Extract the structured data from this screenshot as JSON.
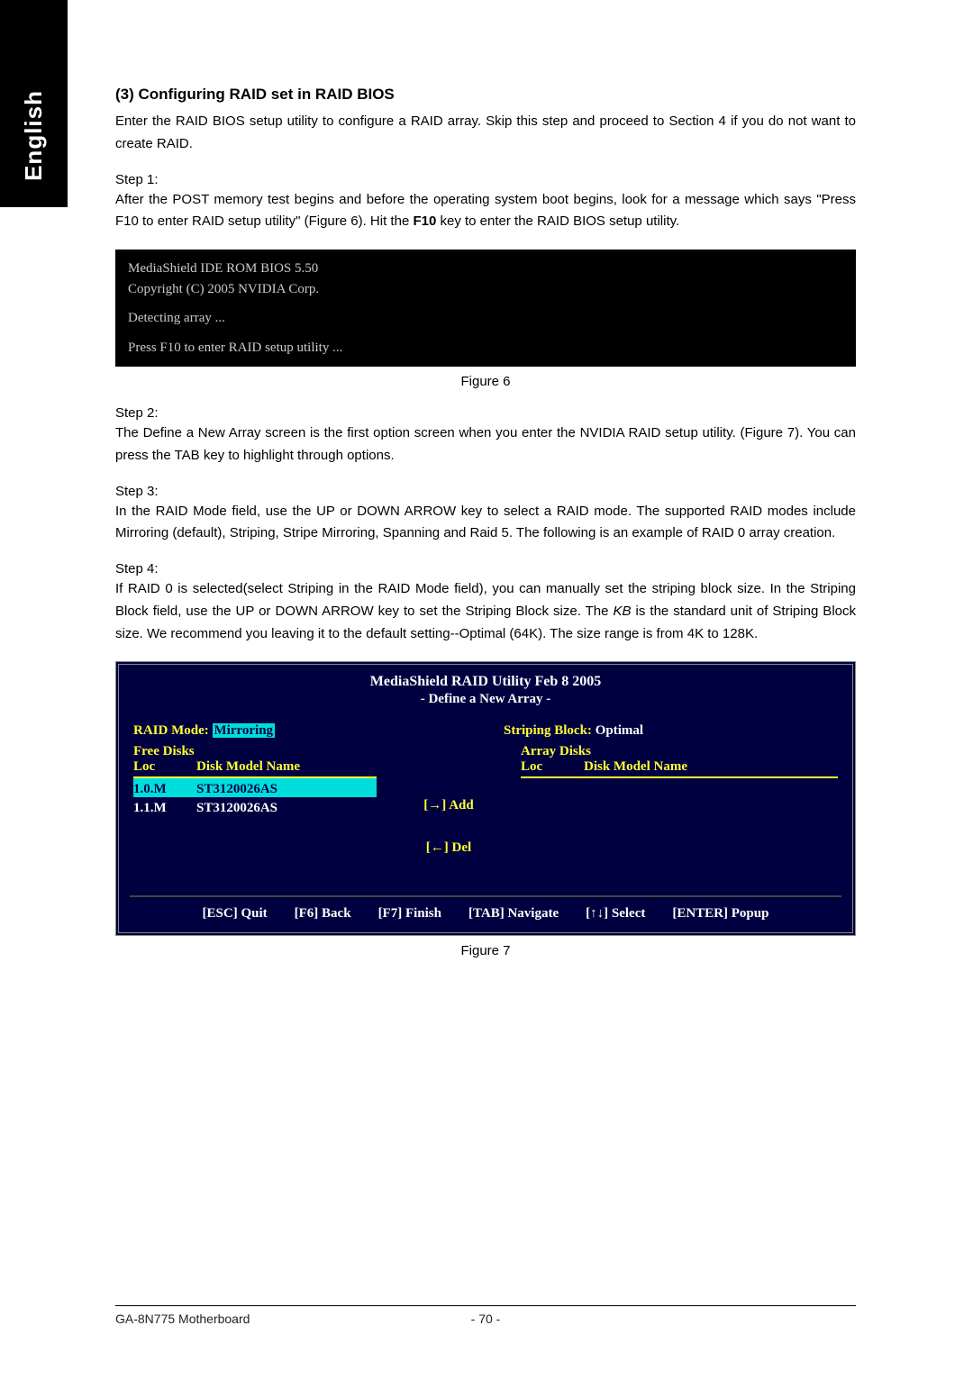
{
  "side_tab": "English",
  "heading": "(3)  Configuring RAID set in RAID BIOS",
  "intro": "Enter the RAID BIOS setup utility to configure a RAID array. Skip this step and proceed to Section 4 if you do not want to create RAID.",
  "step1_label": "Step 1:",
  "step1_text_a": "After the POST memory test begins and before the operating system boot begins, look for a message which says \"Press F10 to enter RAID setup utility\" (Figure 6). Hit the ",
  "step1_key": "F10",
  "step1_text_b": " key to enter the RAID BIOS setup utility.",
  "codeblock": {
    "l1": "MediaShield IDE ROM BIOS 5.50",
    "l2": "Copyright (C) 2005 NVIDIA Corp.",
    "l3": "Detecting array ...",
    "l4": "Press F10 to enter RAID setup utility ..."
  },
  "figure6": "Figure 6",
  "step2_label": "Step 2:",
  "step2_text": "The Define a New Array screen is the first option screen when you enter the NVIDIA RAID setup utility. (Figure 7). You can press the TAB key to highlight through options.",
  "step3_label": "Step 3:",
  "step3_text": "In the RAID Mode field, use the UP or DOWN ARROW key to select a RAID mode. The supported RAID modes include Mirroring (default), Striping, Stripe Mirroring, Spanning and Raid 5. The following is an example of RAID 0 array creation.",
  "step4_label": "Step 4:",
  "step4_text_a": "If RAID 0 is selected(select Striping in the RAID Mode field), you can manually set the striping block size. In the Striping Block field, use the UP or DOWN ARROW key to set the Striping Block size. The ",
  "step4_kb": "KB",
  "step4_text_b": " is the standard unit of Striping Block size. We recommend you leaving it to the default setting--Optimal (64K). The size range is from 4K to 128K.",
  "bios": {
    "title": "MediaShield RAID Utility  Feb 8 2005",
    "subtitle": "- Define a New Array -",
    "raid_mode_label": "RAID Mode:",
    "raid_mode_value": "Mirroring",
    "striping_label": "Striping Block:",
    "striping_value": "Optimal",
    "free_disks_label": "Free Disks",
    "array_disks_label": "Array Disks",
    "col_loc": "Loc",
    "col_model": "Disk Model Name",
    "free_disks": [
      {
        "loc": "1.0.M",
        "model": "ST3120026AS",
        "selected": true
      },
      {
        "loc": "1.1.M",
        "model": "ST3120026AS",
        "selected": false
      }
    ],
    "add_label": "[→] Add",
    "del_label": "[←] Del",
    "footer": [
      "[ESC] Quit",
      "[F6] Back",
      "[F7] Finish",
      "[TAB] Navigate",
      "[↑↓] Select",
      "[ENTER] Popup"
    ]
  },
  "figure7": "Figure 7",
  "footer_left": "GA-8N775 Motherboard",
  "footer_mid": "- 70 -"
}
